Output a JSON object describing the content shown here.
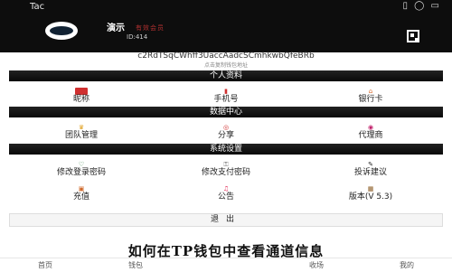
{
  "app": {
    "title": "Tac",
    "status_icons": "▯ ◯ ▭"
  },
  "profile": {
    "name": "演示",
    "badge": "有效会员",
    "id": "ID:414",
    "address": "c2RdTSqCWhff3UaccAadcSCmhkwbQfeBRb",
    "address_note": "点击复制钱包地址"
  },
  "sections": {
    "personal": "个人资料",
    "data_center": "数据中心",
    "settings": "系统设置"
  },
  "personal_items": [
    "昵称",
    "手机号",
    "银行卡"
  ],
  "data_items": [
    "团队管理",
    "分享",
    "代理商"
  ],
  "settings_items": [
    "修改登录密码",
    "修改支付密码",
    "投诉建议",
    "充值",
    "公告",
    "版本(V 5.3)"
  ],
  "logout": "退出",
  "caption": "如何在TP钱包中查看通道信息",
  "nav": [
    "首页",
    "钱包",
    "",
    "收场",
    "我的"
  ],
  "colors": {
    "topbar": "#0d0d0d",
    "accent": "#d03030"
  }
}
